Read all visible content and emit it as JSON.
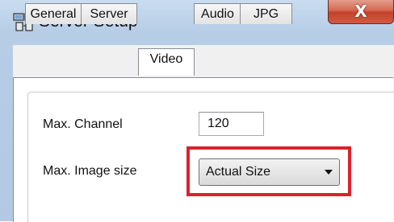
{
  "window": {
    "title": "Server Setup",
    "close_label": "X",
    "icon": "server-setup-icon"
  },
  "tabs": [
    {
      "label": "General"
    },
    {
      "label": "Server"
    },
    {
      "label": "Video",
      "active": true
    },
    {
      "label": "Audio"
    },
    {
      "label": "JPG"
    }
  ],
  "video": {
    "max_channel_label": "Max. Channel",
    "max_channel_value": "120",
    "max_image_size_label": "Max. Image size",
    "max_image_size_value": "Actual Size"
  },
  "colors": {
    "highlight": "#d9232b",
    "close_button": "#c2432c"
  }
}
